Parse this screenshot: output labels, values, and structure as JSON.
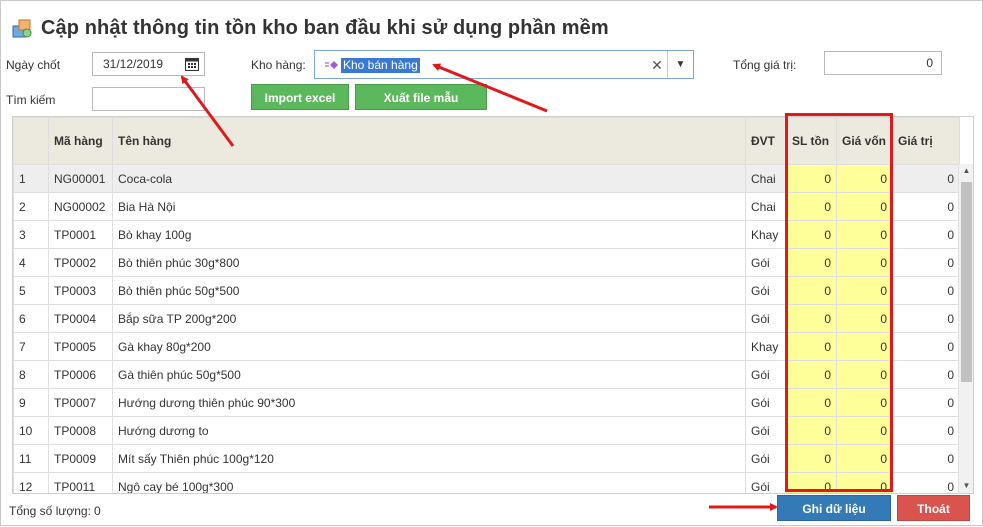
{
  "title": "Cập nhật thông tin tồn kho ban đầu khi sử dụng phần mềm",
  "form": {
    "ngay_chot_label": "Ngày chốt",
    "ngay_chot_value": "31/12/2019",
    "tim_kiem_label": "Tìm kiếm",
    "tim_kiem_value": "",
    "kho_hang_label": "Kho hàng:",
    "kho_hang_value": "Kho bán hàng",
    "tong_gia_tri_label": "Tổng giá trị:",
    "tong_gia_tri_value": "0"
  },
  "buttons": {
    "import": "Import excel",
    "export": "Xuất file mẫu",
    "save": "Ghi dữ liệu",
    "exit": "Thoát"
  },
  "table": {
    "headers": {
      "stt": "",
      "ma_hang": "Mã hàng",
      "ten_hang": "Tên hàng",
      "dvt": "ĐVT",
      "sl_ton": "SL tồn",
      "gia_von": "Giá vốn",
      "gia_tri": "Giá trị"
    },
    "rows": [
      {
        "stt": "1",
        "ma": "NG00001",
        "ten": "Coca-cola",
        "dvt": "Chai",
        "sl": "0",
        "gv": "0",
        "gt": "0"
      },
      {
        "stt": "2",
        "ma": "NG00002",
        "ten": "Bia Hà Nội",
        "dvt": "Chai",
        "sl": "0",
        "gv": "0",
        "gt": "0"
      },
      {
        "stt": "3",
        "ma": "TP0001",
        "ten": "Bò khay 100g",
        "dvt": "Khay",
        "sl": "0",
        "gv": "0",
        "gt": "0"
      },
      {
        "stt": "4",
        "ma": "TP0002",
        "ten": "Bò thiên phúc 30g*800",
        "dvt": "Gói",
        "sl": "0",
        "gv": "0",
        "gt": "0"
      },
      {
        "stt": "5",
        "ma": "TP0003",
        "ten": "Bò thiên phúc 50g*500",
        "dvt": "Gói",
        "sl": "0",
        "gv": "0",
        "gt": "0"
      },
      {
        "stt": "6",
        "ma": "TP0004",
        "ten": "Bắp sữa TP 200g*200",
        "dvt": "Gói",
        "sl": "0",
        "gv": "0",
        "gt": "0"
      },
      {
        "stt": "7",
        "ma": "TP0005",
        "ten": "Gà khay 80g*200",
        "dvt": "Khay",
        "sl": "0",
        "gv": "0",
        "gt": "0"
      },
      {
        "stt": "8",
        "ma": "TP0006",
        "ten": "Gà thiên phúc 50g*500",
        "dvt": "Gói",
        "sl": "0",
        "gv": "0",
        "gt": "0"
      },
      {
        "stt": "9",
        "ma": "TP0007",
        "ten": "Hướng dương thiên phúc 90*300",
        "dvt": "Gói",
        "sl": "0",
        "gv": "0",
        "gt": "0"
      },
      {
        "stt": "10",
        "ma": "TP0008",
        "ten": "Hướng dương to",
        "dvt": "Gói",
        "sl": "0",
        "gv": "0",
        "gt": "0"
      },
      {
        "stt": "11",
        "ma": "TP0009",
        "ten": "Mít sấy Thiên phúc 100g*120",
        "dvt": "Gói",
        "sl": "0",
        "gv": "0",
        "gt": "0"
      },
      {
        "stt": "12",
        "ma": "TP0011",
        "ten": "Ngô cay bé 100g*300",
        "dvt": "Gói",
        "sl": "0",
        "gv": "0",
        "gt": "0"
      }
    ]
  },
  "footer": {
    "total_label": "Tổng số lượng:",
    "total_value": "0"
  },
  "colors": {
    "annotation_red": "#e0191b",
    "editable_yellow": "#ffff99",
    "button_green": "#5cb85c",
    "button_blue": "#337ab7",
    "button_red": "#d9534f"
  },
  "icons": {
    "title": "package-boxes-icon",
    "date_picker": "calendar-icon",
    "combo_tag": "tag-icon",
    "clear": "close-icon",
    "dropdown": "caret-down-icon"
  }
}
